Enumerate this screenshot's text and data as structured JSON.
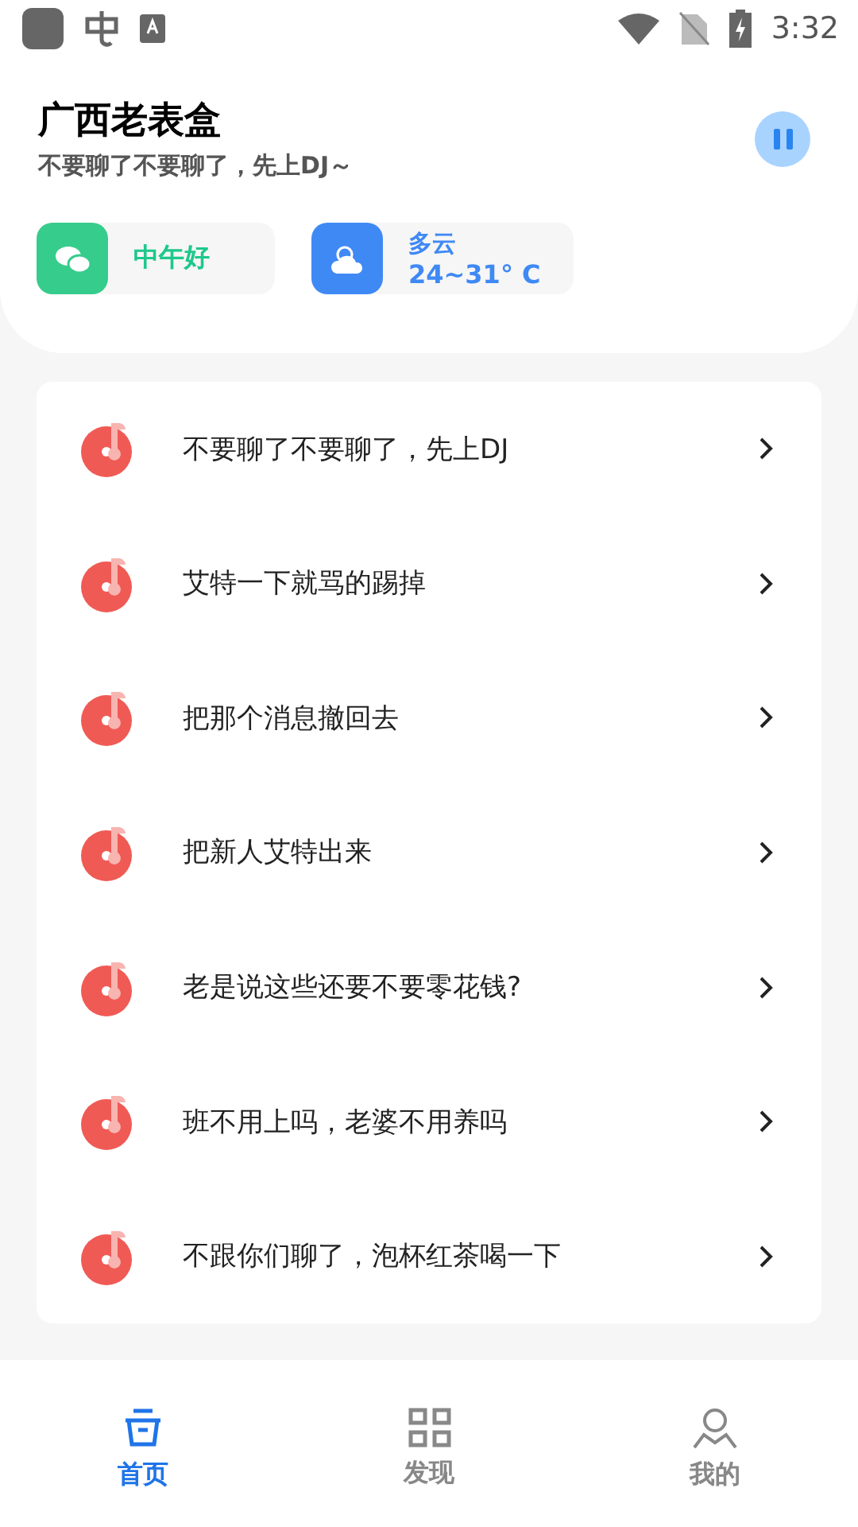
{
  "status_bar": {
    "time": "3:32"
  },
  "header": {
    "title": "广西老表盒",
    "subtitle": "不要聊了不要聊了，先上DJ～",
    "playing": true
  },
  "greeting": {
    "text": "中午好"
  },
  "weather": {
    "condition": "多云",
    "temperature": "24~31° C"
  },
  "songs": [
    {
      "title": "不要聊了不要聊了，先上DJ"
    },
    {
      "title": "艾特一下就骂的踢掉"
    },
    {
      "title": "把那个消息撤回去"
    },
    {
      "title": "把新人艾特出来"
    },
    {
      "title": "老是说这些还要不要零花钱?"
    },
    {
      "title": "班不用上吗，老婆不用养吗"
    },
    {
      "title": "不跟你们聊了，泡杯红茶喝一下"
    }
  ],
  "tabs": [
    {
      "label": "首页",
      "kind": "home",
      "selected": true
    },
    {
      "label": "发现",
      "kind": "discover",
      "selected": false
    },
    {
      "label": "我的",
      "kind": "profile",
      "selected": false
    }
  ]
}
